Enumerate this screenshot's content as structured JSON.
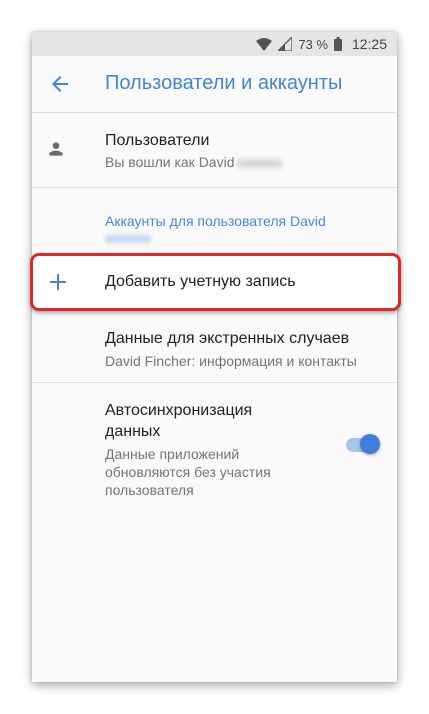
{
  "status_bar": {
    "battery_percent": "73 %",
    "time": "12:25",
    "icons": [
      "wifi-icon",
      "signal-icon",
      "battery-icon"
    ]
  },
  "app_bar": {
    "back_icon": "arrow-left-icon",
    "title": "Пользователи и аккаунты"
  },
  "users": {
    "icon": "person-icon",
    "title": "Пользователи",
    "subtitle": "Вы вошли как David"
  },
  "accounts_header": "Аккаунты для пользователя David",
  "add_account": {
    "icon": "plus-icon",
    "label": "Добавить учетную запись"
  },
  "emergency": {
    "title": "Данные для экстренных случаев",
    "subtitle": "David Fincher: информация и контакты"
  },
  "autosync": {
    "title_line1": "Автосинхронизация",
    "title_line2": "данных",
    "summary_line1": "Данные приложений",
    "summary_line2": "обновляются без участия",
    "summary_line3": "пользователя",
    "enabled": true
  },
  "colors": {
    "accent": "#4285d4",
    "highlight_border": "#d82a2a",
    "toggle_thumb": "#3f7fdc",
    "toggle_track": "#a8c5ef"
  }
}
